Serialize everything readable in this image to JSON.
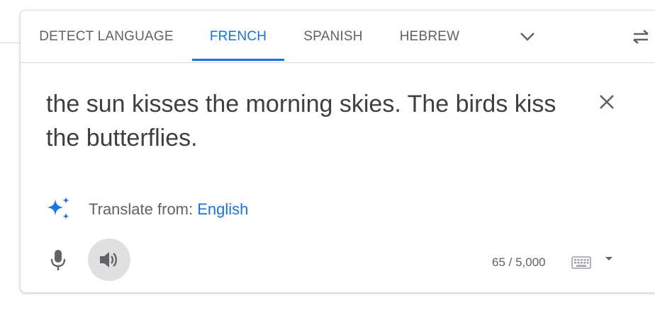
{
  "tabs": [
    {
      "label": "DETECT LANGUAGE",
      "active": false
    },
    {
      "label": "FRENCH",
      "active": true
    },
    {
      "label": "SPANISH",
      "active": false
    },
    {
      "label": "HEBREW",
      "active": false
    }
  ],
  "source": {
    "text": "the sun kisses the morning skies. The birds kiss the butterflies."
  },
  "suggestion": {
    "prefix": "Translate from: ",
    "language": "English"
  },
  "counter": "65 / 5,000",
  "icons": {
    "more_languages": "chevron-down-icon",
    "swap": "swap-languages-icon",
    "clear": "close-icon",
    "sparkle": "sparkle-icon",
    "mic": "microphone-icon",
    "listen": "speaker-icon",
    "keyboard": "keyboard-icon",
    "keyboard_menu": "caret-down-icon"
  },
  "colors": {
    "accent": "#1a73e8",
    "text": "#3c4043",
    "muted": "#5f6368"
  }
}
